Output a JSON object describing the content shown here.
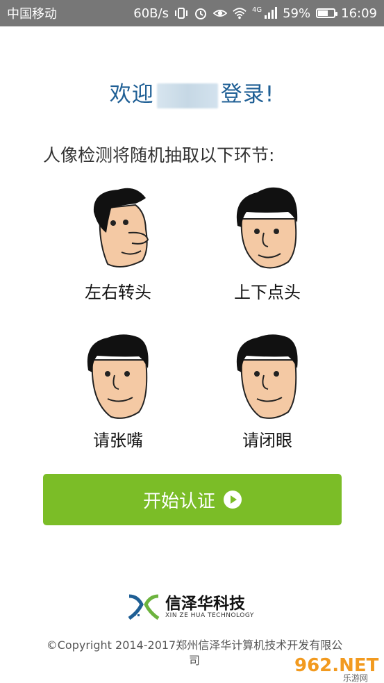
{
  "status_bar": {
    "carrier": "中国移动",
    "speed": "60B/s",
    "network": "4G",
    "battery": "59%",
    "time": "16:09",
    "icons": [
      "vibrate-icon",
      "alarm-icon",
      "eye-icon",
      "wifi-icon",
      "signal-icon",
      "battery-icon"
    ]
  },
  "welcome": {
    "prefix": "欢迎",
    "suffix": "登录!"
  },
  "intro": "人像检测将随机抽取以下环节:",
  "faces": [
    {
      "label": "左右转头",
      "icon": "turn-head-icon"
    },
    {
      "label": "上下点头",
      "icon": "nod-head-icon"
    },
    {
      "label": "请张嘴",
      "icon": "open-mouth-icon"
    },
    {
      "label": "请闭眼",
      "icon": "close-eyes-icon"
    }
  ],
  "start_button": {
    "label": "开始认证",
    "icon": "play-circle-icon",
    "color": "#7bbd27"
  },
  "logo": {
    "name": "信泽华科技",
    "en": "XIN ZE HUA TECHNOLOGY"
  },
  "copyright": "©Copyright 2014-2017郑州信泽华计算机技术开发有限公司",
  "watermark": {
    "text": "962.NET",
    "sub": "乐游网"
  },
  "colors": {
    "accent": "#7bbd27",
    "welcome": "#1f5f95",
    "statusbar": "#777777"
  }
}
